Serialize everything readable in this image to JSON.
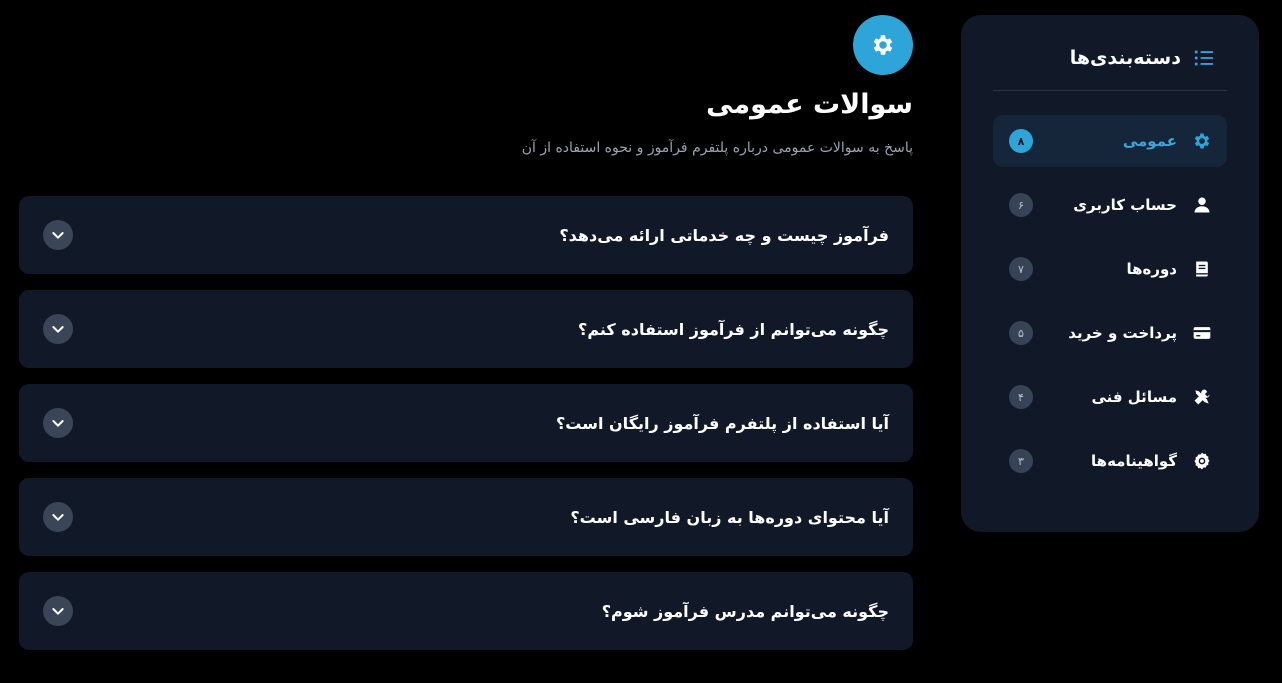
{
  "colors": {
    "accent": "#2ea5d8",
    "panel": "#111827",
    "background": "#000000",
    "muted_text": "#9aa3b2"
  },
  "sidebar": {
    "title": "دسته‌بندی‌ها",
    "title_icon": "list-icon",
    "items": [
      {
        "label": "عمومی",
        "count": "۸",
        "icon": "gear-icon",
        "active": true
      },
      {
        "label": "حساب کاربری",
        "count": "۶",
        "icon": "user-icon",
        "active": false
      },
      {
        "label": "دوره‌ها",
        "count": "۷",
        "icon": "book-icon",
        "active": false
      },
      {
        "label": "پرداخت و خرید",
        "count": "۵",
        "icon": "credit-card-icon",
        "active": false
      },
      {
        "label": "مسائل فنی",
        "count": "۴",
        "icon": "tools-icon",
        "active": false
      },
      {
        "label": "گواهینامه‌ها",
        "count": "۳",
        "icon": "award-icon",
        "active": false
      }
    ]
  },
  "main": {
    "header_icon": "gear-icon",
    "title": "سوالات عمومی",
    "subtitle": "پاسخ به سوالات عمومی درباره پلتفرم فرآموز و نحوه استفاده از آن",
    "faqs": [
      {
        "question": "فرآموز چیست و چه خدماتی ارائه می‌دهد؟",
        "expanded": false
      },
      {
        "question": "چگونه می‌توانم از فرآموز استفاده کنم؟",
        "expanded": false
      },
      {
        "question": "آیا استفاده از پلتفرم فرآموز رایگان است؟",
        "expanded": false
      },
      {
        "question": "آیا محتوای دوره‌ها به زبان فارسی است؟",
        "expanded": false
      },
      {
        "question": "چگونه می‌توانم مدرس فرآموز شوم؟",
        "expanded": false
      }
    ]
  }
}
